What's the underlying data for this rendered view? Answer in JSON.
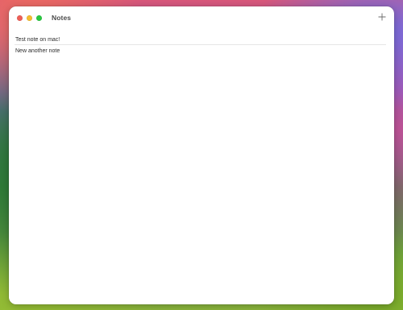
{
  "window": {
    "title": "Notes"
  },
  "toolbar": {
    "add_icon": "plus-icon"
  },
  "traffic_lights": {
    "close_color": "#ee5f57",
    "minimize_color": "#f5bd2f",
    "maximize_color": "#29c840"
  },
  "notes": [
    {
      "text": "Test note on mac!"
    },
    {
      "text": "New another note"
    }
  ]
}
